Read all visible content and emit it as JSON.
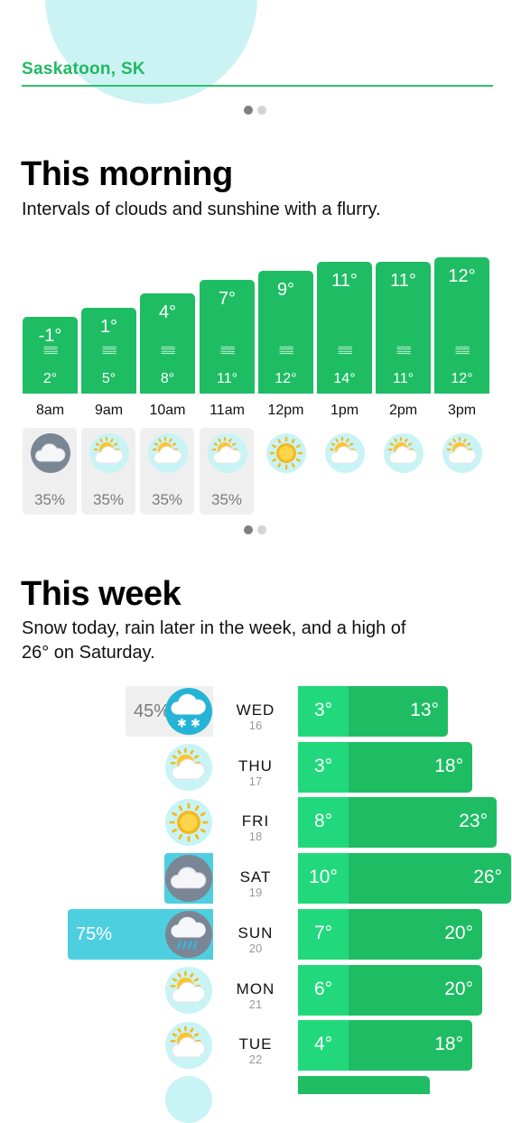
{
  "location": "Saskatoon, SK",
  "morning": {
    "title": "This morning",
    "summary": "Intervals of clouds and sunshine with a flurry.",
    "hours": [
      {
        "time": "8am",
        "temp": "-1°",
        "feels": "2°",
        "icon": "cloudy-icon",
        "precip": "35%",
        "temp_value": -1
      },
      {
        "time": "9am",
        "temp": "1°",
        "feels": "5°",
        "icon": "partly-sunny-icon",
        "precip": "35%",
        "temp_value": 1
      },
      {
        "time": "10am",
        "temp": "4°",
        "feels": "8°",
        "icon": "partly-sunny-icon",
        "precip": "35%",
        "temp_value": 4
      },
      {
        "time": "11am",
        "temp": "7°",
        "feels": "11°",
        "icon": "partly-sunny-icon",
        "precip": "35%",
        "temp_value": 7
      },
      {
        "time": "12pm",
        "temp": "9°",
        "feels": "12°",
        "icon": "sunny-icon",
        "precip": "",
        "temp_value": 9
      },
      {
        "time": "1pm",
        "temp": "11°",
        "feels": "14°",
        "icon": "partly-sunny-icon",
        "precip": "",
        "temp_value": 11
      },
      {
        "time": "2pm",
        "temp": "11°",
        "feels": "11°",
        "icon": "partly-sunny-icon",
        "precip": "",
        "temp_value": 11
      },
      {
        "time": "3pm",
        "temp": "12°",
        "feels": "12°",
        "icon": "partly-sunny-icon",
        "precip": "",
        "temp_value": 12
      }
    ]
  },
  "week": {
    "title": "This week",
    "summary_line1": "Snow today, rain later in the week, and a high of",
    "summary_line2": "26° on Saturday.",
    "days": [
      {
        "day": "WED",
        "date": "16",
        "low": "3°",
        "high": "13°",
        "low_value": 3,
        "high_value": 13,
        "precip": "45%",
        "precip_value": 45,
        "icon": "snow-icon"
      },
      {
        "day": "THU",
        "date": "17",
        "low": "3°",
        "high": "18°",
        "low_value": 3,
        "high_value": 18,
        "precip": "",
        "precip_value": 0,
        "icon": "partly-sunny-icon"
      },
      {
        "day": "FRI",
        "date": "18",
        "low": "8°",
        "high": "23°",
        "low_value": 8,
        "high_value": 23,
        "precip": "",
        "precip_value": 0,
        "icon": "sunny-icon"
      },
      {
        "day": "SAT",
        "date": "19",
        "low": "10°",
        "high": "26°",
        "low_value": 10,
        "high_value": 26,
        "precip": "25%",
        "precip_value": 25,
        "icon": "cloudy-icon"
      },
      {
        "day": "SUN",
        "date": "20",
        "low": "7°",
        "high": "20°",
        "low_value": 7,
        "high_value": 20,
        "precip": "75%",
        "precip_value": 75,
        "icon": "rain-icon"
      },
      {
        "day": "MON",
        "date": "21",
        "low": "6°",
        "high": "20°",
        "low_value": 6,
        "high_value": 20,
        "precip": "",
        "precip_value": 0,
        "icon": "partly-sunny-icon"
      },
      {
        "day": "TUE",
        "date": "22",
        "low": "4°",
        "high": "18°",
        "low_value": 4,
        "high_value": 18,
        "precip": "",
        "precip_value": 0,
        "icon": "partly-sunny-icon"
      }
    ]
  },
  "colors": {
    "accent": "#21b863",
    "bar": "#1ebd63",
    "bar_light": "#21d97c",
    "precip": "#4dcfe0",
    "snow_precip": "#efefef"
  }
}
